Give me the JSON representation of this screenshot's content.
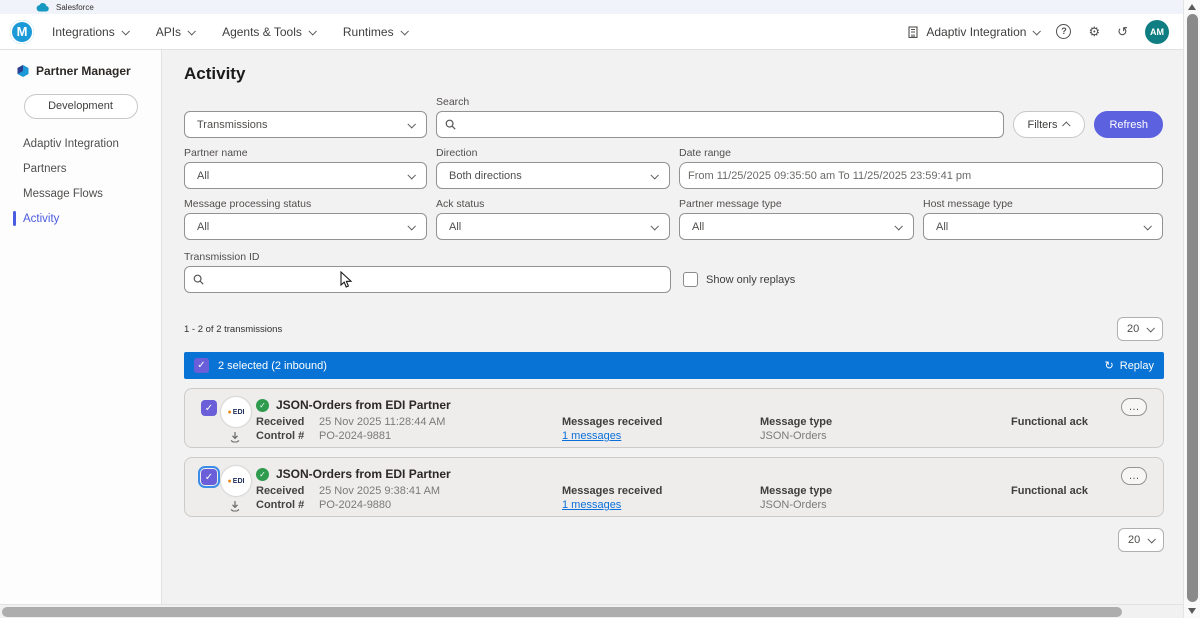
{
  "brand_bar": {
    "label": "Salesforce"
  },
  "navbar": {
    "menus": [
      "Integrations",
      "APIs",
      "Agents & Tools",
      "Runtimes"
    ],
    "org_label": "Adaptiv Integration",
    "avatar_initials": "AM"
  },
  "sidebar": {
    "app_title": "Partner Manager",
    "environment_button": "Development",
    "items": [
      {
        "label": "Adaptiv Integration"
      },
      {
        "label": "Partners"
      },
      {
        "label": "Message Flows"
      },
      {
        "label": "Activity"
      }
    ]
  },
  "activity": {
    "page_title": "Activity",
    "record_type_select": "Transmissions",
    "search": {
      "label": "Search",
      "value": ""
    },
    "filters_button": "Filters",
    "refresh_button": "Refresh",
    "filter_fields": [
      {
        "label": "Partner name",
        "value": "All"
      },
      {
        "label": "Direction",
        "value": "Both directions"
      },
      {
        "label": "Date range",
        "value": "From 11/25/2025 09:35:50 am To 11/25/2025 23:59:41 pm"
      },
      {
        "label": "Message processing status",
        "value": "All"
      },
      {
        "label": "Ack status",
        "value": "All"
      },
      {
        "label": "Partner message type",
        "value": "All"
      },
      {
        "label": "Host message type",
        "value": "All"
      }
    ],
    "transmission_id": {
      "label": "Transmission ID",
      "value": ""
    },
    "show_only_replays_label": "Show only replays",
    "results_summary": "1 - 2 of 2 transmissions",
    "page_size_top": "20",
    "page_size_bottom": "20",
    "selection_bar": {
      "label": "2 selected (2 inbound)",
      "replay_label": "Replay"
    },
    "transmissions": [
      {
        "partner_logo_text": "EDI",
        "title": "JSON-Orders from EDI Partner",
        "received_label": "Received",
        "received_value": "25 Nov 2025 11:28:44 AM",
        "control_label": "Control #",
        "control_value": "PO-2024-9881",
        "messages_label": "Messages received",
        "messages_link": "1 messages",
        "message_type_label": "Message type",
        "message_type_value": "JSON-Orders",
        "functional_ack_label": "Functional ack"
      },
      {
        "partner_logo_text": "EDI",
        "title": "JSON-Orders from EDI Partner",
        "received_label": "Received",
        "received_value": "25 Nov 2025 9:38:41 AM",
        "control_label": "Control #",
        "control_value": "PO-2024-9880",
        "messages_label": "Messages received",
        "messages_link": "1 messages",
        "message_type_label": "Message type",
        "message_type_value": "JSON-Orders",
        "functional_ack_label": "Functional ack"
      }
    ]
  },
  "icons": {
    "checkmark": "✓",
    "ellipsis": "…",
    "replay": "↻",
    "help": "?",
    "gear": "⚙",
    "history": "↺",
    "logo_letter": "M",
    "logo_dot": "◉"
  },
  "colors": {
    "accent_indigo": "#5c61e0",
    "selection_blue": "#0873d4",
    "link_blue": "#0b6fd9",
    "success_green": "#2e9b4f",
    "avatar_teal": "#0e7e82",
    "mulesoft_blue": "#1b9ad7"
  }
}
